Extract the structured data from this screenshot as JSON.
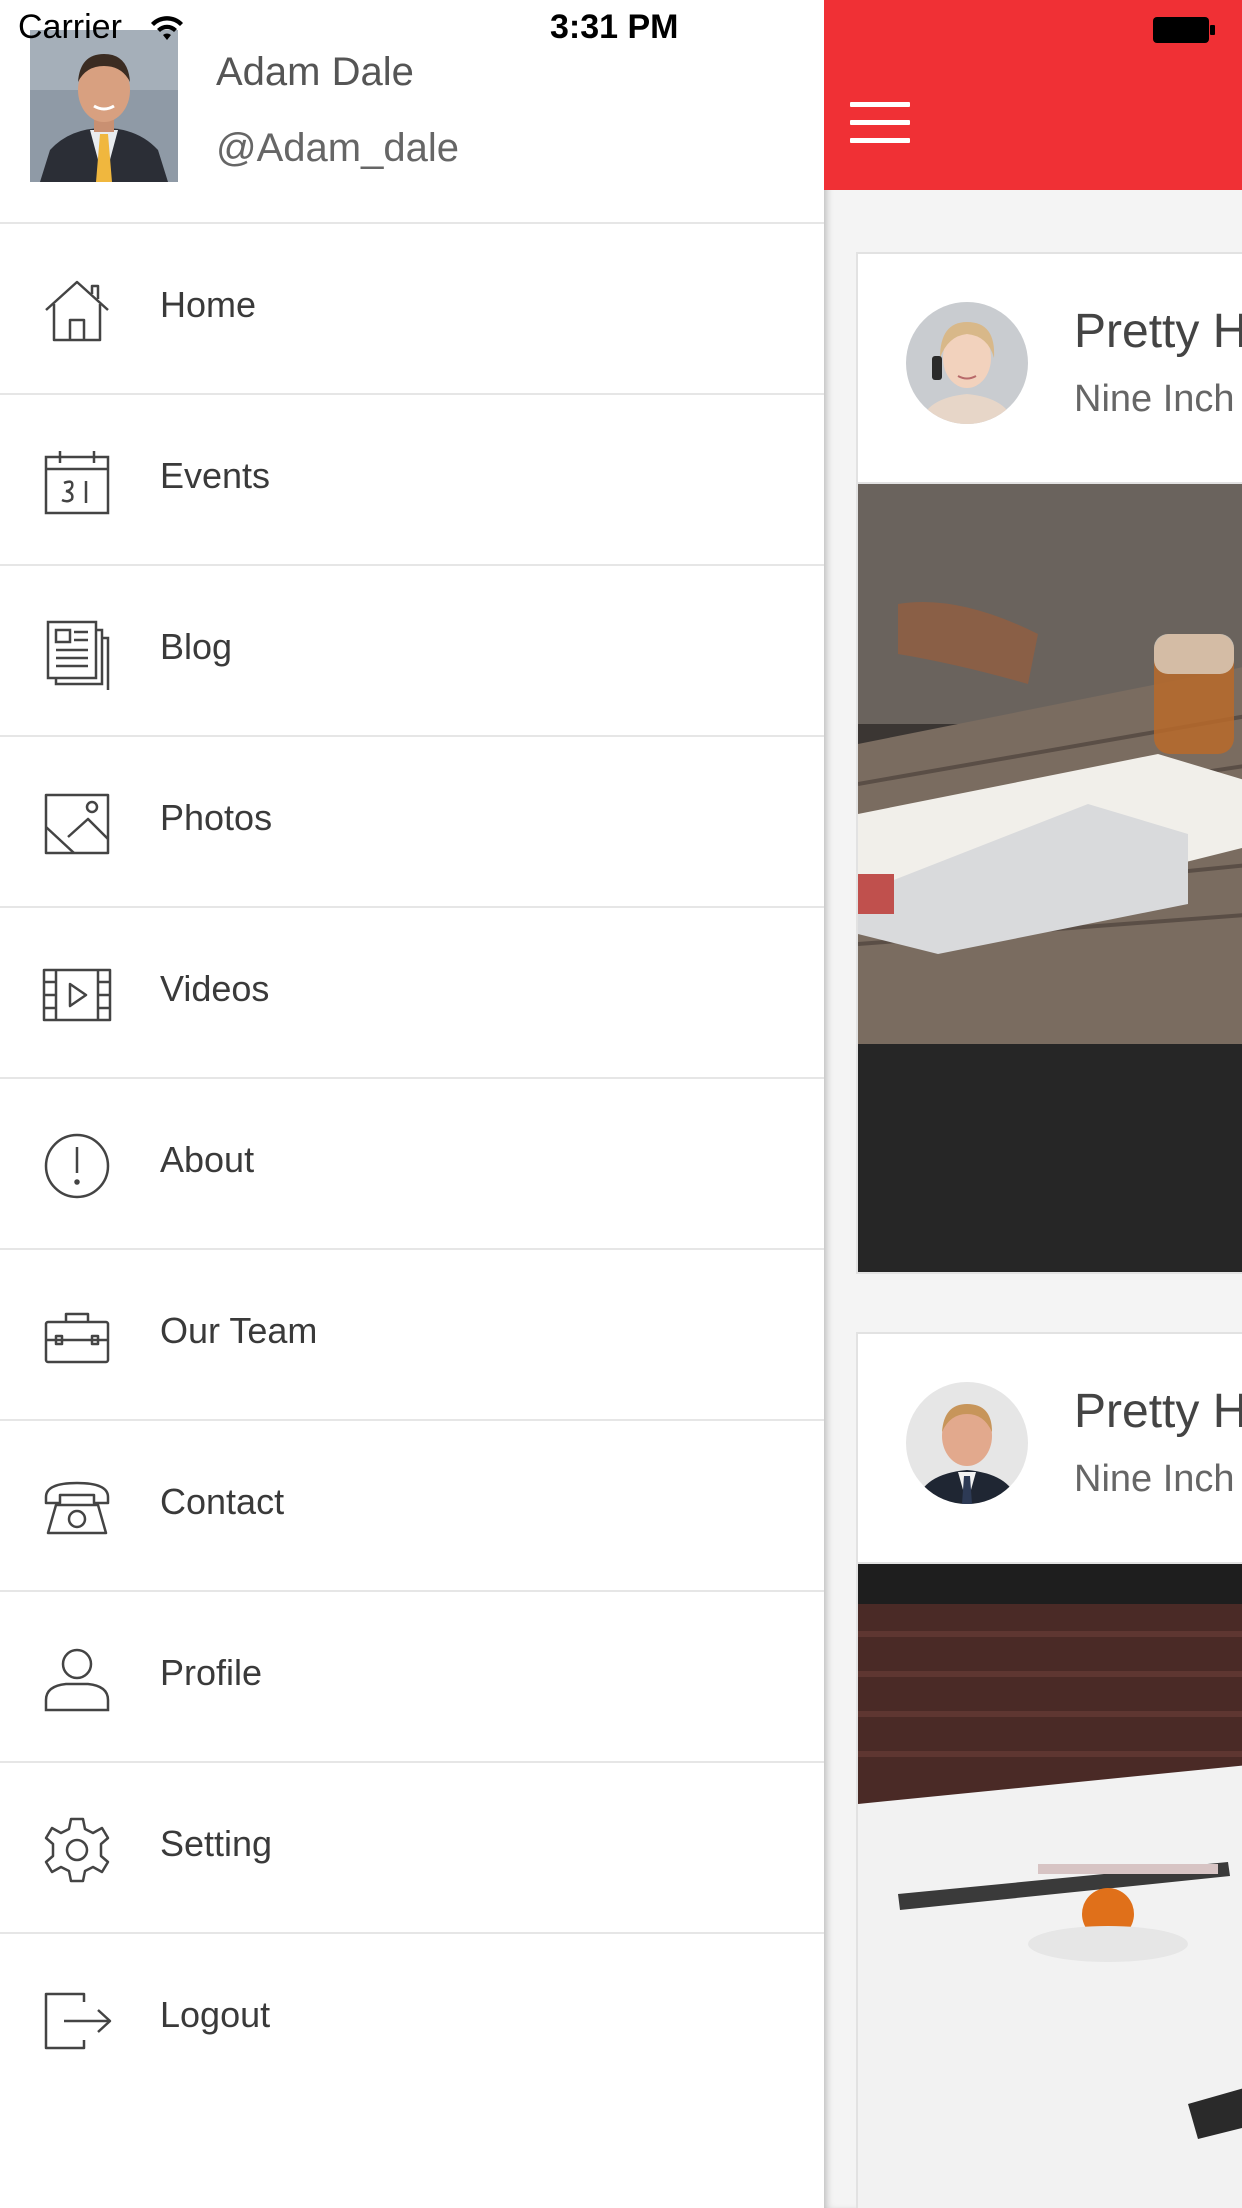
{
  "status_bar": {
    "carrier": "Carrier",
    "time": "3:31 PM"
  },
  "user": {
    "name": "Adam Dale",
    "handle": "@Adam_dale"
  },
  "menu": [
    {
      "label": "Home",
      "icon": "home-icon"
    },
    {
      "label": "Events",
      "icon": "calendar-icon"
    },
    {
      "label": "Blog",
      "icon": "newspaper-icon"
    },
    {
      "label": "Photos",
      "icon": "image-icon"
    },
    {
      "label": "Videos",
      "icon": "video-icon"
    },
    {
      "label": "About",
      "icon": "info-icon"
    },
    {
      "label": "Our Team",
      "icon": "briefcase-icon"
    },
    {
      "label": "Contact",
      "icon": "telephone-icon"
    },
    {
      "label": "Profile",
      "icon": "person-icon"
    },
    {
      "label": "Setting",
      "icon": "gear-icon"
    },
    {
      "label": "Logout",
      "icon": "logout-icon"
    }
  ],
  "colors": {
    "accent": "#f03035",
    "divider": "#e6e6e6",
    "text": "#3a3a3a"
  },
  "feed": [
    {
      "title": "Pretty H",
      "subtitle": "Nine Inch"
    },
    {
      "title": "Pretty H",
      "subtitle": "Nine Inch"
    }
  ]
}
